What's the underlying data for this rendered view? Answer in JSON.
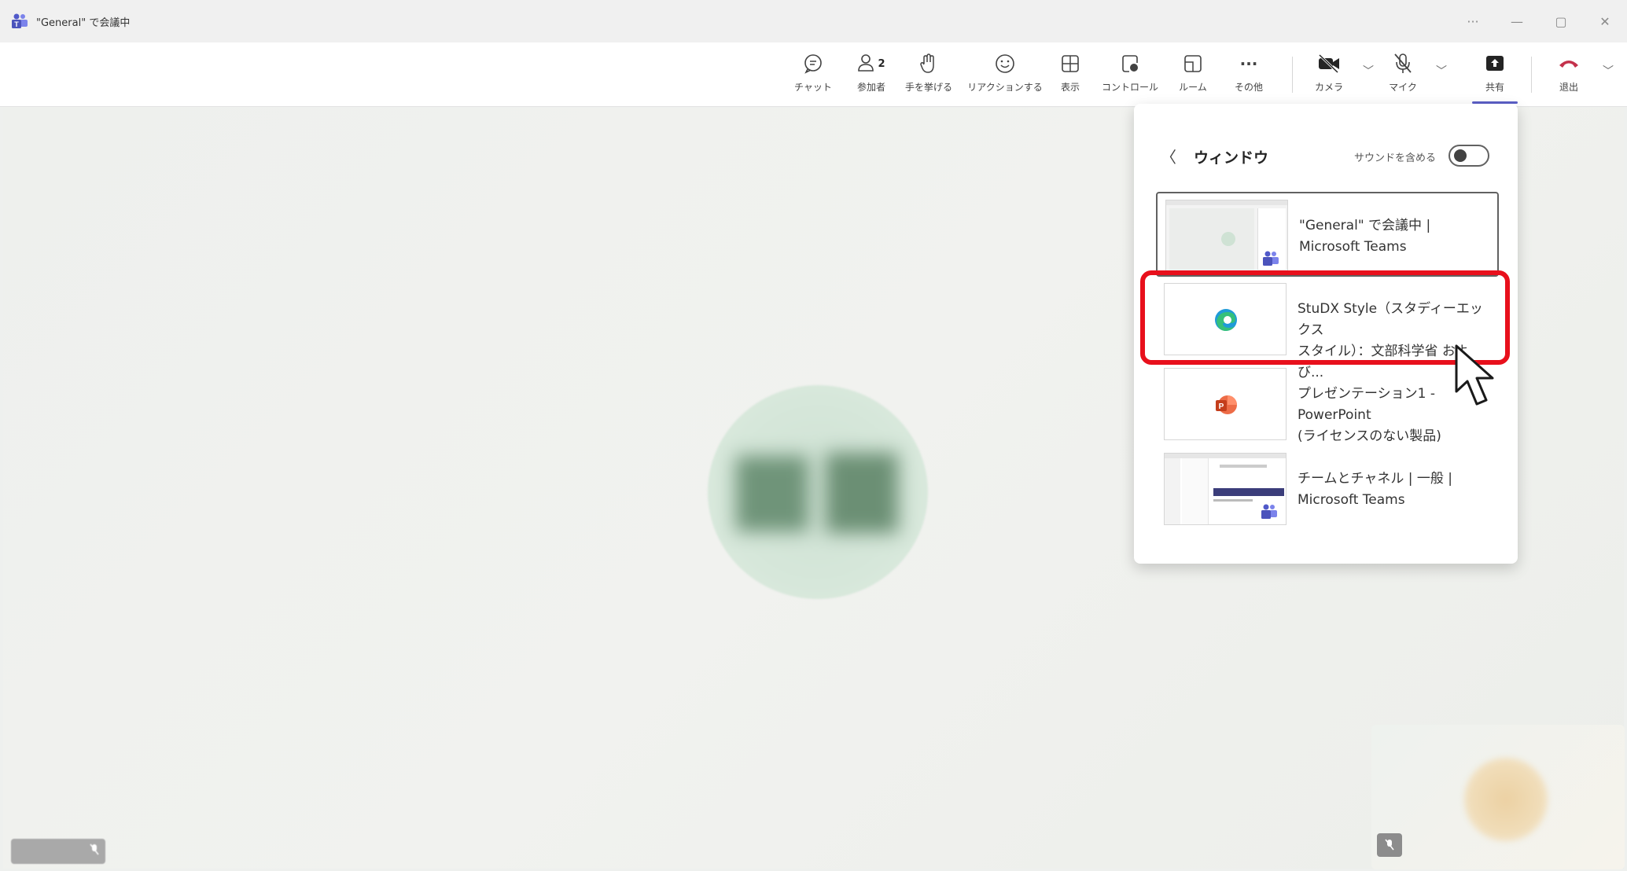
{
  "window": {
    "title": "\"General\" で会議中",
    "controls": {
      "more": "···",
      "minimize": "—",
      "restore": "▢",
      "close": "✕"
    }
  },
  "toolbar": {
    "chat": "チャット",
    "participants": "参加者",
    "participants_count": "2",
    "raise_hand": "手を挙げる",
    "react": "リアクションする",
    "view": "表示",
    "control": "コントロール",
    "rooms": "ルーム",
    "more": "その他",
    "camera": "カメラ",
    "mic": "マイク",
    "share": "共有",
    "leave": "退出"
  },
  "share_panel": {
    "back_glyph": "〈",
    "title": "ウィンドウ",
    "sound_label": "サウンドを含める",
    "include_sound": false,
    "windows": [
      {
        "title_line1": "\"General\" で会議中 |",
        "title_line2": "Microsoft Teams",
        "icon": "teams-icon",
        "selected": true
      },
      {
        "title_line1": "StuDX Style（スタディーエックス",
        "title_line2": "スタイル）：文部科学省 および...",
        "icon": "edge-icon",
        "selected": false
      },
      {
        "title_line1": "プレゼンテーション1 - PowerPoint",
        "title_line2": "(ライセンスのない製品)",
        "icon": "powerpoint-icon",
        "selected": false
      },
      {
        "title_line1": "チームとチャネル | 一般 |",
        "title_line2": "Microsoft Teams",
        "icon": "teams-icon",
        "selected": false
      }
    ]
  },
  "colors": {
    "accent": "#5b5fc7",
    "leave_red": "#c4314b",
    "highlight_red": "#e8101c"
  }
}
